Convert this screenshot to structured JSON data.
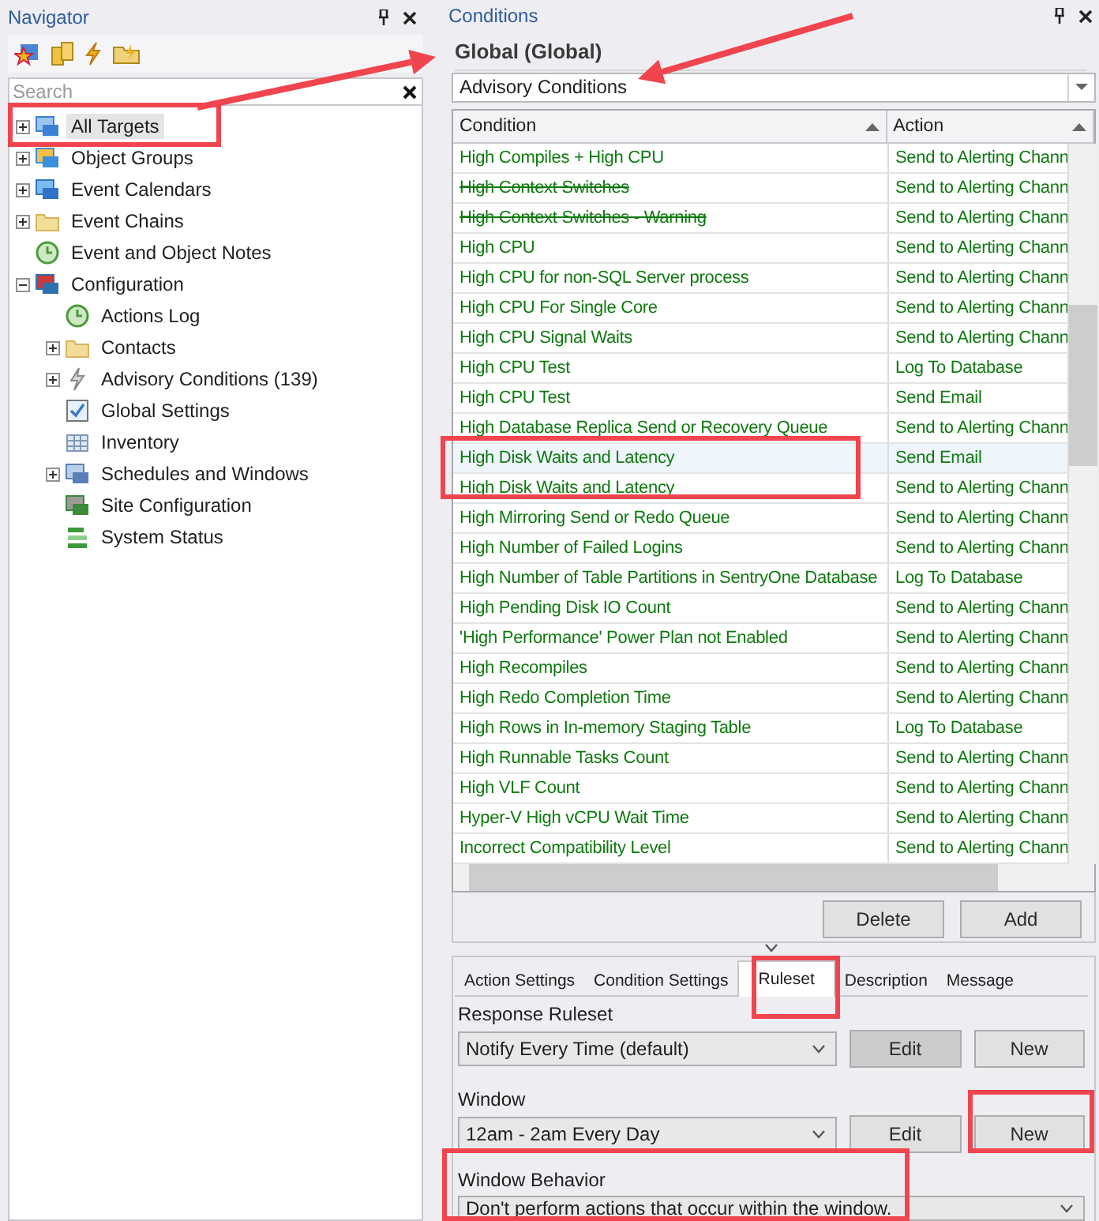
{
  "navigator": {
    "title": "Navigator",
    "search": {
      "placeholder": "Search"
    },
    "tree": [
      {
        "label": "All Targets",
        "expanded": false,
        "selected": true
      },
      {
        "label": "Object Groups",
        "expanded": false,
        "selected": false
      },
      {
        "label": "Event Calendars",
        "expanded": false,
        "selected": false
      },
      {
        "label": "Event Chains",
        "expanded": false,
        "selected": false
      },
      {
        "label": "Event and Object Notes",
        "selected": false
      },
      {
        "label": "Configuration",
        "expanded": true,
        "selected": false,
        "children": [
          {
            "label": "Actions Log",
            "selected": false
          },
          {
            "label": "Contacts",
            "expanded": false,
            "selected": false
          },
          {
            "label": "Advisory Conditions (139)",
            "expanded": false,
            "selected": false
          },
          {
            "label": "Global Settings",
            "selected": false
          },
          {
            "label": "Inventory",
            "selected": false
          },
          {
            "label": "Schedules and Windows",
            "expanded": false,
            "selected": false
          },
          {
            "label": "Site Configuration",
            "selected": false
          },
          {
            "label": "System Status",
            "selected": false
          }
        ]
      }
    ]
  },
  "conditions": {
    "title": "Conditions",
    "heading": "Global (Global)",
    "view": "Advisory Conditions",
    "table": {
      "columns": [
        "Condition",
        "Action"
      ],
      "rows": [
        {
          "condition": "High Compiles + High CPU",
          "action": "Send to Alerting Chann",
          "disabled": false,
          "selected": false
        },
        {
          "condition": "High Context Switches",
          "action": "Send to Alerting Chann",
          "disabled": true,
          "selected": false
        },
        {
          "condition": "High Context Switches - Warning",
          "action": "Send to Alerting Chann",
          "disabled": true,
          "selected": false
        },
        {
          "condition": "High CPU",
          "action": "Send to Alerting Chann",
          "disabled": false,
          "selected": false
        },
        {
          "condition": "High CPU for non-SQL Server process",
          "action": "Send to Alerting Chann",
          "disabled": false,
          "selected": false
        },
        {
          "condition": "High CPU For Single Core",
          "action": "Send to Alerting Chann",
          "disabled": false,
          "selected": false
        },
        {
          "condition": "High CPU Signal Waits",
          "action": "Send to Alerting Chann",
          "disabled": false,
          "selected": false
        },
        {
          "condition": "High CPU Test",
          "action": "Log To Database",
          "disabled": false,
          "selected": false
        },
        {
          "condition": "High CPU Test",
          "action": "Send Email",
          "disabled": false,
          "selected": false
        },
        {
          "condition": "High Database Replica Send or Recovery Queue",
          "action": "Send to Alerting Chann",
          "disabled": false,
          "selected": false
        },
        {
          "condition": "High Disk Waits and Latency",
          "action": "Send Email",
          "disabled": false,
          "selected": true
        },
        {
          "condition": "High Disk Waits and Latency",
          "action": "Send to Alerting Chann",
          "disabled": false,
          "selected": false
        },
        {
          "condition": "High Mirroring Send or Redo Queue",
          "action": "Send to Alerting Chann",
          "disabled": false,
          "selected": false
        },
        {
          "condition": "High Number of Failed Logins",
          "action": "Send to Alerting Chann",
          "disabled": false,
          "selected": false
        },
        {
          "condition": "High Number of Table Partitions in SentryOne Database",
          "action": "Log To Database",
          "disabled": false,
          "selected": false
        },
        {
          "condition": "High Pending Disk IO Count",
          "action": "Send to Alerting Chann",
          "disabled": false,
          "selected": false
        },
        {
          "condition": "'High Performance' Power Plan not Enabled",
          "action": "Send to Alerting Chann",
          "disabled": false,
          "selected": false
        },
        {
          "condition": "High Recompiles",
          "action": "Send to Alerting Chann",
          "disabled": false,
          "selected": false
        },
        {
          "condition": "High Redo Completion Time",
          "action": "Send to Alerting Chann",
          "disabled": false,
          "selected": false
        },
        {
          "condition": "High Rows in In-memory Staging Table",
          "action": "Log To Database",
          "disabled": false,
          "selected": false
        },
        {
          "condition": "High Runnable Tasks Count",
          "action": "Send to Alerting Chann",
          "disabled": false,
          "selected": false
        },
        {
          "condition": "High VLF Count",
          "action": "Send to Alerting Chann",
          "disabled": false,
          "selected": false
        },
        {
          "condition": "Hyper-V High vCPU Wait Time",
          "action": "Send to Alerting Chann",
          "disabled": false,
          "selected": false
        },
        {
          "condition": "Incorrect Compatibility Level",
          "action": "Send to Alerting Chann",
          "disabled": false,
          "selected": false
        }
      ]
    },
    "buttons": [
      "Delete",
      "Add"
    ],
    "tabs": [
      {
        "label": "Action Settings",
        "selected": false
      },
      {
        "label": "Condition Settings",
        "selected": false
      },
      {
        "label": "Ruleset",
        "selected": true
      },
      {
        "label": "Description",
        "selected": false
      },
      {
        "label": "Message",
        "selected": false
      }
    ],
    "ruleset": {
      "response_ruleset": {
        "label": "Response Ruleset",
        "value": "Notify Every Time (default)",
        "edit": {
          "label": "Edit",
          "disabled": true
        },
        "new": "New"
      },
      "window": {
        "label": "Window",
        "value": "12am - 2am Every Day",
        "edit": {
          "label": "Edit",
          "disabled": false
        },
        "new": "New"
      },
      "window_behavior": {
        "label": "Window Behavior",
        "value": "Don't perform actions that occur within the window."
      }
    }
  }
}
